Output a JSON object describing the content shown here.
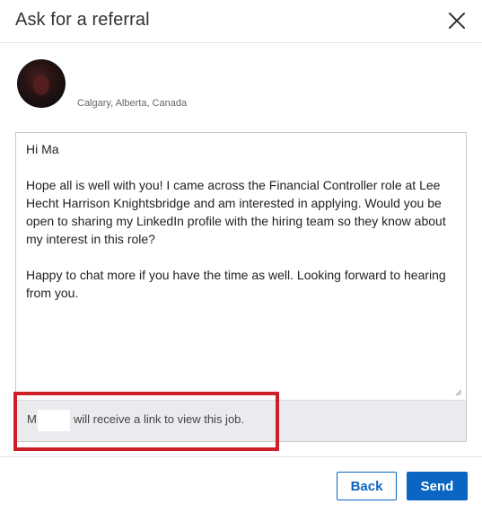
{
  "modal": {
    "title": "Ask for a referral",
    "close_icon": "close-icon"
  },
  "profile": {
    "location": "Calgary, Alberta, Canada",
    "avatar_icon": "avatar"
  },
  "message": {
    "body": "Hi Ma\n\nHope all is well with you! I came across the Financial Controller role at Lee Hecht Harrison Knightsbridge and am interested in applying. Would you be open to sharing my LinkedIn profile with the hiring team so they know about my interest in this role?\n\nHappy to chat more if you have the time as well. Looking forward to hearing from you."
  },
  "notice": {
    "prefix": "M",
    "suffix": "will receive a link to view this job."
  },
  "footer": {
    "back_label": "Back",
    "send_label": "Send"
  },
  "colors": {
    "accent": "#0a66c2",
    "highlight": "#cc1f27",
    "notice_bg": "#e9ebee"
  }
}
